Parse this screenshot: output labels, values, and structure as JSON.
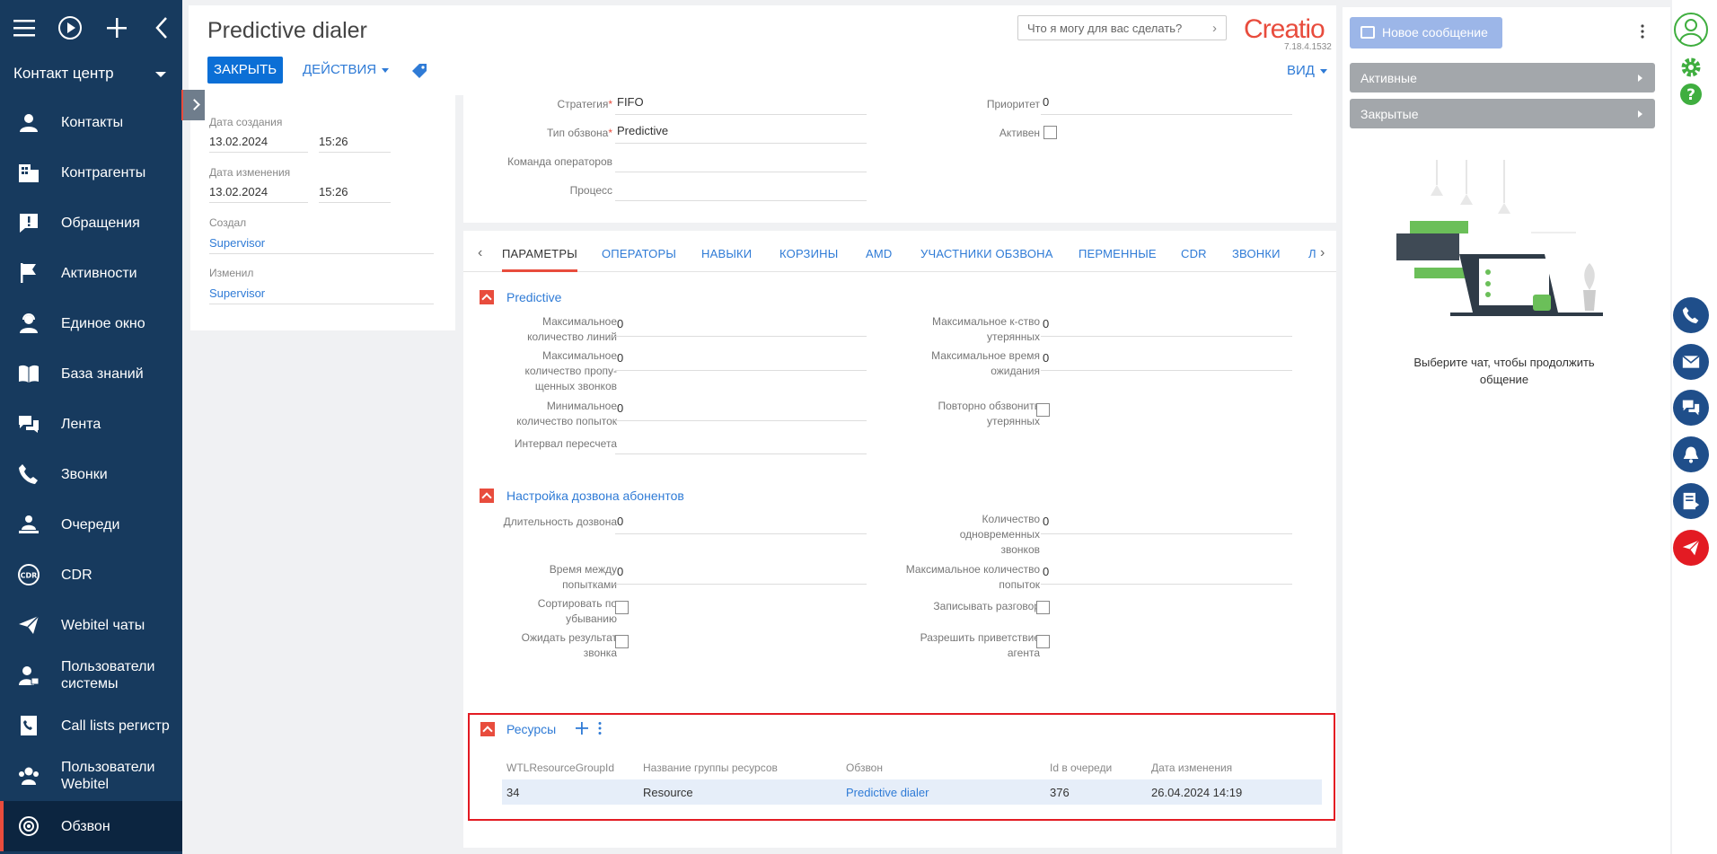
{
  "sidebar": {
    "section": "Контакт центр",
    "items": [
      {
        "label": "Контакты",
        "icon": "contact-icon"
      },
      {
        "label": "Контрагенты",
        "icon": "accounts-icon"
      },
      {
        "label": "Обращения",
        "icon": "cases-icon"
      },
      {
        "label": "Активности",
        "icon": "flag-icon"
      },
      {
        "label": "Единое окно",
        "icon": "agent-icon"
      },
      {
        "label": "База знаний",
        "icon": "book-icon"
      },
      {
        "label": "Лента",
        "icon": "feed-icon"
      },
      {
        "label": "Звонки",
        "icon": "phone-icon"
      },
      {
        "label": "Очереди",
        "icon": "queue-icon"
      },
      {
        "label": "CDR",
        "icon": "cdr-icon"
      },
      {
        "label": "Webitel чаты",
        "icon": "send-icon"
      },
      {
        "label": "Пользователи системы",
        "icon": "users-lock-icon"
      },
      {
        "label": "Call lists регистр",
        "icon": "call-list-icon"
      },
      {
        "label": "Пользователи Webitel",
        "icon": "users-icon"
      },
      {
        "label": "Обзвон",
        "icon": "dialer-icon"
      }
    ]
  },
  "header": {
    "title": "Predictive dialer",
    "close_label": "ЗАКРЫТЬ",
    "actions_label": "ДЕЙСТВИЯ",
    "search_placeholder": "Что я могу для вас сделать?",
    "logo": "Creatio",
    "version": "7.18.4.1532",
    "view_label": "ВИД"
  },
  "info": {
    "created_label": "Дата создания",
    "created_date": "13.02.2024",
    "created_time": "15:26",
    "modified_label": "Дата изменения",
    "modified_date": "13.02.2024",
    "modified_time": "15:26",
    "author_label": "Создал",
    "author": "Supervisor",
    "editor_label": "Изменил",
    "editor": "Supervisor"
  },
  "upper": {
    "strategy_label": "Стратегия",
    "strategy": "FIFO",
    "priority_label": "Приоритет",
    "priority": "0",
    "dial_type_label": "Тип обзвона",
    "dial_type": "Predictive",
    "active_label": "Активен",
    "team_label": "Команда операторов",
    "team": "",
    "process_label": "Процесс",
    "process": ""
  },
  "tabs": [
    "ПАРАМЕТРЫ",
    "ОПЕРАТОРЫ",
    "НАВЫКИ",
    "КОРЗИНЫ",
    "AMD",
    "УЧАСТНИКИ ОБЗВОНА",
    "ПЕРМЕННЫЕ",
    "CDR",
    "ЗВОНКИ",
    "Л"
  ],
  "predictive": {
    "title": "Predictive",
    "max_lines_label": "Максимальное количество линий",
    "max_lines": "0",
    "max_lost_label": "Максимальное к-ство утерянных",
    "max_lost": "0",
    "max_missed_label": "Максимальное количество пропу-щенных звонков",
    "max_missed": "0",
    "max_wait_label": "Максимальное время ожидания",
    "max_wait": "0",
    "min_attempts_label": "Минимальное количество попыток",
    "min_attempts": "0",
    "redial_lost_label": "Повторно обзвонить утерянных",
    "recalc_label": "Интервал пересчета",
    "recalc": ""
  },
  "dial": {
    "title": "Настройка дозвона абонентов",
    "duration_label": "Длительность дозвона",
    "duration": "0",
    "concurrent_label": "Количество одновременных звонков",
    "concurrent": "0",
    "between_label": "Время между попытками",
    "between": "0",
    "max_attempts_label": "Максимальное количество попыток",
    "max_attempts": "0",
    "sort_label": "Сортировать по убыванию",
    "record_label": "Записывать разговор",
    "wait_result_label": "Ожидать результат звонка",
    "greeting_label": "Разрешить приветствие агента"
  },
  "resources": {
    "title": "Ресурсы",
    "columns": [
      "WTLResourceGroupId",
      "Название группы ресурсов",
      "Обзвон",
      "Id в очереди",
      "Дата изменения"
    ],
    "rows": [
      [
        "34",
        "Resource",
        "Predictive dialer",
        "376",
        "26.04.2024 14:19"
      ]
    ]
  },
  "chat": {
    "new_message": "Новое сообщение",
    "active": "Активные",
    "closed": "Закрытые",
    "empty_text": "Выберите чат, чтобы продолжить общение"
  },
  "colors": {
    "accent": "#e84c3d",
    "primary": "#0b6fd6",
    "sidebar": "#173a5e",
    "highlight": "#e31b23"
  }
}
